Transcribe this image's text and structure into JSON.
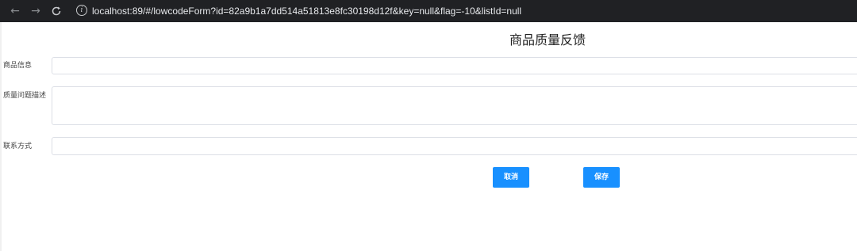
{
  "browser": {
    "url": "localhost:89/#/lowcodeForm?id=82a9b1a7dd514a51813e8fc30198d12f&key=null&flag=-10&listId=null",
    "back_glyph": "←",
    "forward_glyph": "→",
    "reload_glyph": "C",
    "info_glyph": "i"
  },
  "form": {
    "title": "商品质量反馈",
    "fields": [
      {
        "label": "商品信息",
        "value": ""
      },
      {
        "label": "质量问题描述",
        "value": ""
      },
      {
        "label": "联系方式",
        "value": ""
      }
    ],
    "buttons": {
      "cancel": "取消",
      "save": "保存"
    }
  },
  "colors": {
    "primary": "#1890ff",
    "toolbar": "#202124",
    "input_border": "#dcdfe6"
  },
  "icons": [
    "back-arrow-icon",
    "forward-arrow-icon",
    "reload-icon",
    "info-icon"
  ]
}
